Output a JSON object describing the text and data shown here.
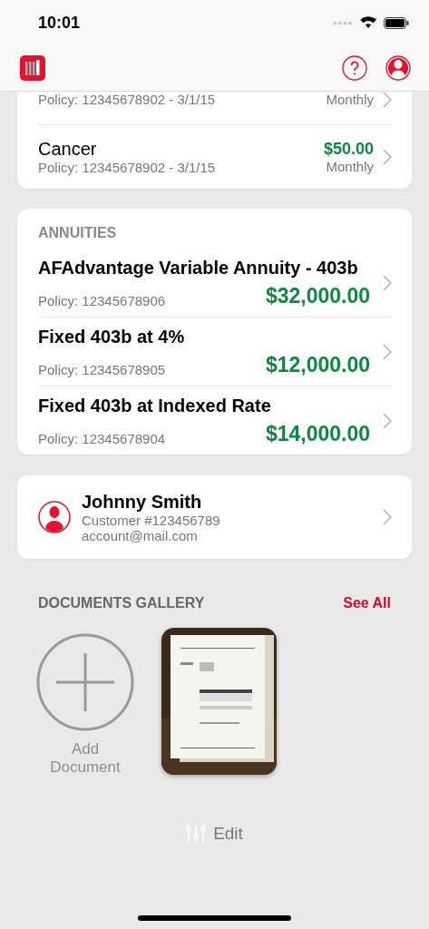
{
  "status_bar": {
    "time": "10:01"
  },
  "top_card": {
    "rows": [
      {
        "policy": "Policy: 12345678902  - 3/1/15",
        "frequency": "Monthly"
      },
      {
        "title": "Cancer",
        "policy": "Policy: 12345678902  - 3/1/15",
        "amount": "$50.00",
        "frequency": "Monthly"
      }
    ]
  },
  "annuities": {
    "heading": "ANNUITIES",
    "rows": [
      {
        "title": "AFAdvantage Variable Annuity - 403b",
        "policy": "Policy: 12345678906",
        "amount": "$32,000.00"
      },
      {
        "title": "Fixed 403b at 4%",
        "policy": "Policy: 12345678905",
        "amount": "$12,000.00"
      },
      {
        "title": "Fixed 403b at Indexed Rate",
        "policy": "Policy: 12345678904",
        "amount": "$14,000.00"
      }
    ]
  },
  "profile": {
    "name": "Johnny Smith",
    "customer": "Customer #123456789",
    "email": "account@mail.com"
  },
  "documents": {
    "heading": "DOCUMENTS GALLERY",
    "see_all": "See All",
    "add_label": "Add Document"
  },
  "edit_button": "Edit"
}
